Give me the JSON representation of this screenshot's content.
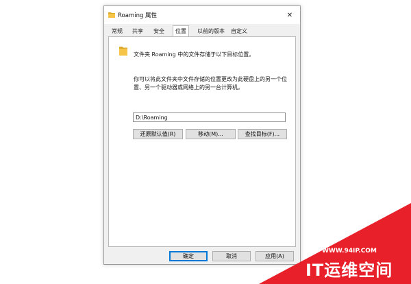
{
  "window": {
    "title": "Roaming 属性",
    "close_glyph": "✕"
  },
  "tabs": [
    {
      "label": "常规",
      "active": false
    },
    {
      "label": "共享",
      "active": false
    },
    {
      "label": "安全",
      "active": false
    },
    {
      "label": "位置",
      "active": true
    },
    {
      "label": "以前的版本",
      "active": false
    },
    {
      "label": "自定义",
      "active": false
    }
  ],
  "location": {
    "description": "文件夹 Roaming 中的文件存储于以下目标位置。",
    "help_text": "你可以将此文件夹中文件存储的位置更改为此硬盘上的另一个位置、另一个驱动器或网络上的另一台计算机。",
    "path_value": "D:\\Roaming",
    "restore_default_label": "还原默认值(R)",
    "move_label": "移动(M)...",
    "find_target_label": "查找目标(F)..."
  },
  "footer": {
    "ok_label": "确定",
    "cancel_label": "取消",
    "apply_label": "应用(A)"
  },
  "watermark": {
    "url": "WWW.94IP.COM",
    "brand": "IT运维空间",
    "color": "#e8202a"
  },
  "icons": {
    "title": "folder-icon",
    "content": "folder-icon"
  },
  "colors": {
    "dialog_bg": "#f0f0f0",
    "panel_bg": "#ffffff",
    "focus_border": "#0078d7",
    "folder_yellow": "#f6c548"
  }
}
